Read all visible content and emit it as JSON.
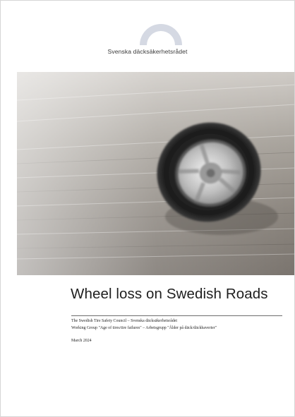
{
  "logo": {
    "organization_name": "Svenska däcksäkerhetsrådet",
    "arch_color": "#d5d9e3"
  },
  "cover_image": {
    "description_icon": "spinning-wheel-photo"
  },
  "document": {
    "title": "Wheel loss on Swedish Roads",
    "council_line": "The Swedish Tire Safety Council – Svenska däcksäkerhetsrådet",
    "working_group_line": "Working Group \"Age of tires/tire failures\" – Arbetsgrupp \"Ålder på däck/däckhaverier\"",
    "date": "March 2024"
  }
}
